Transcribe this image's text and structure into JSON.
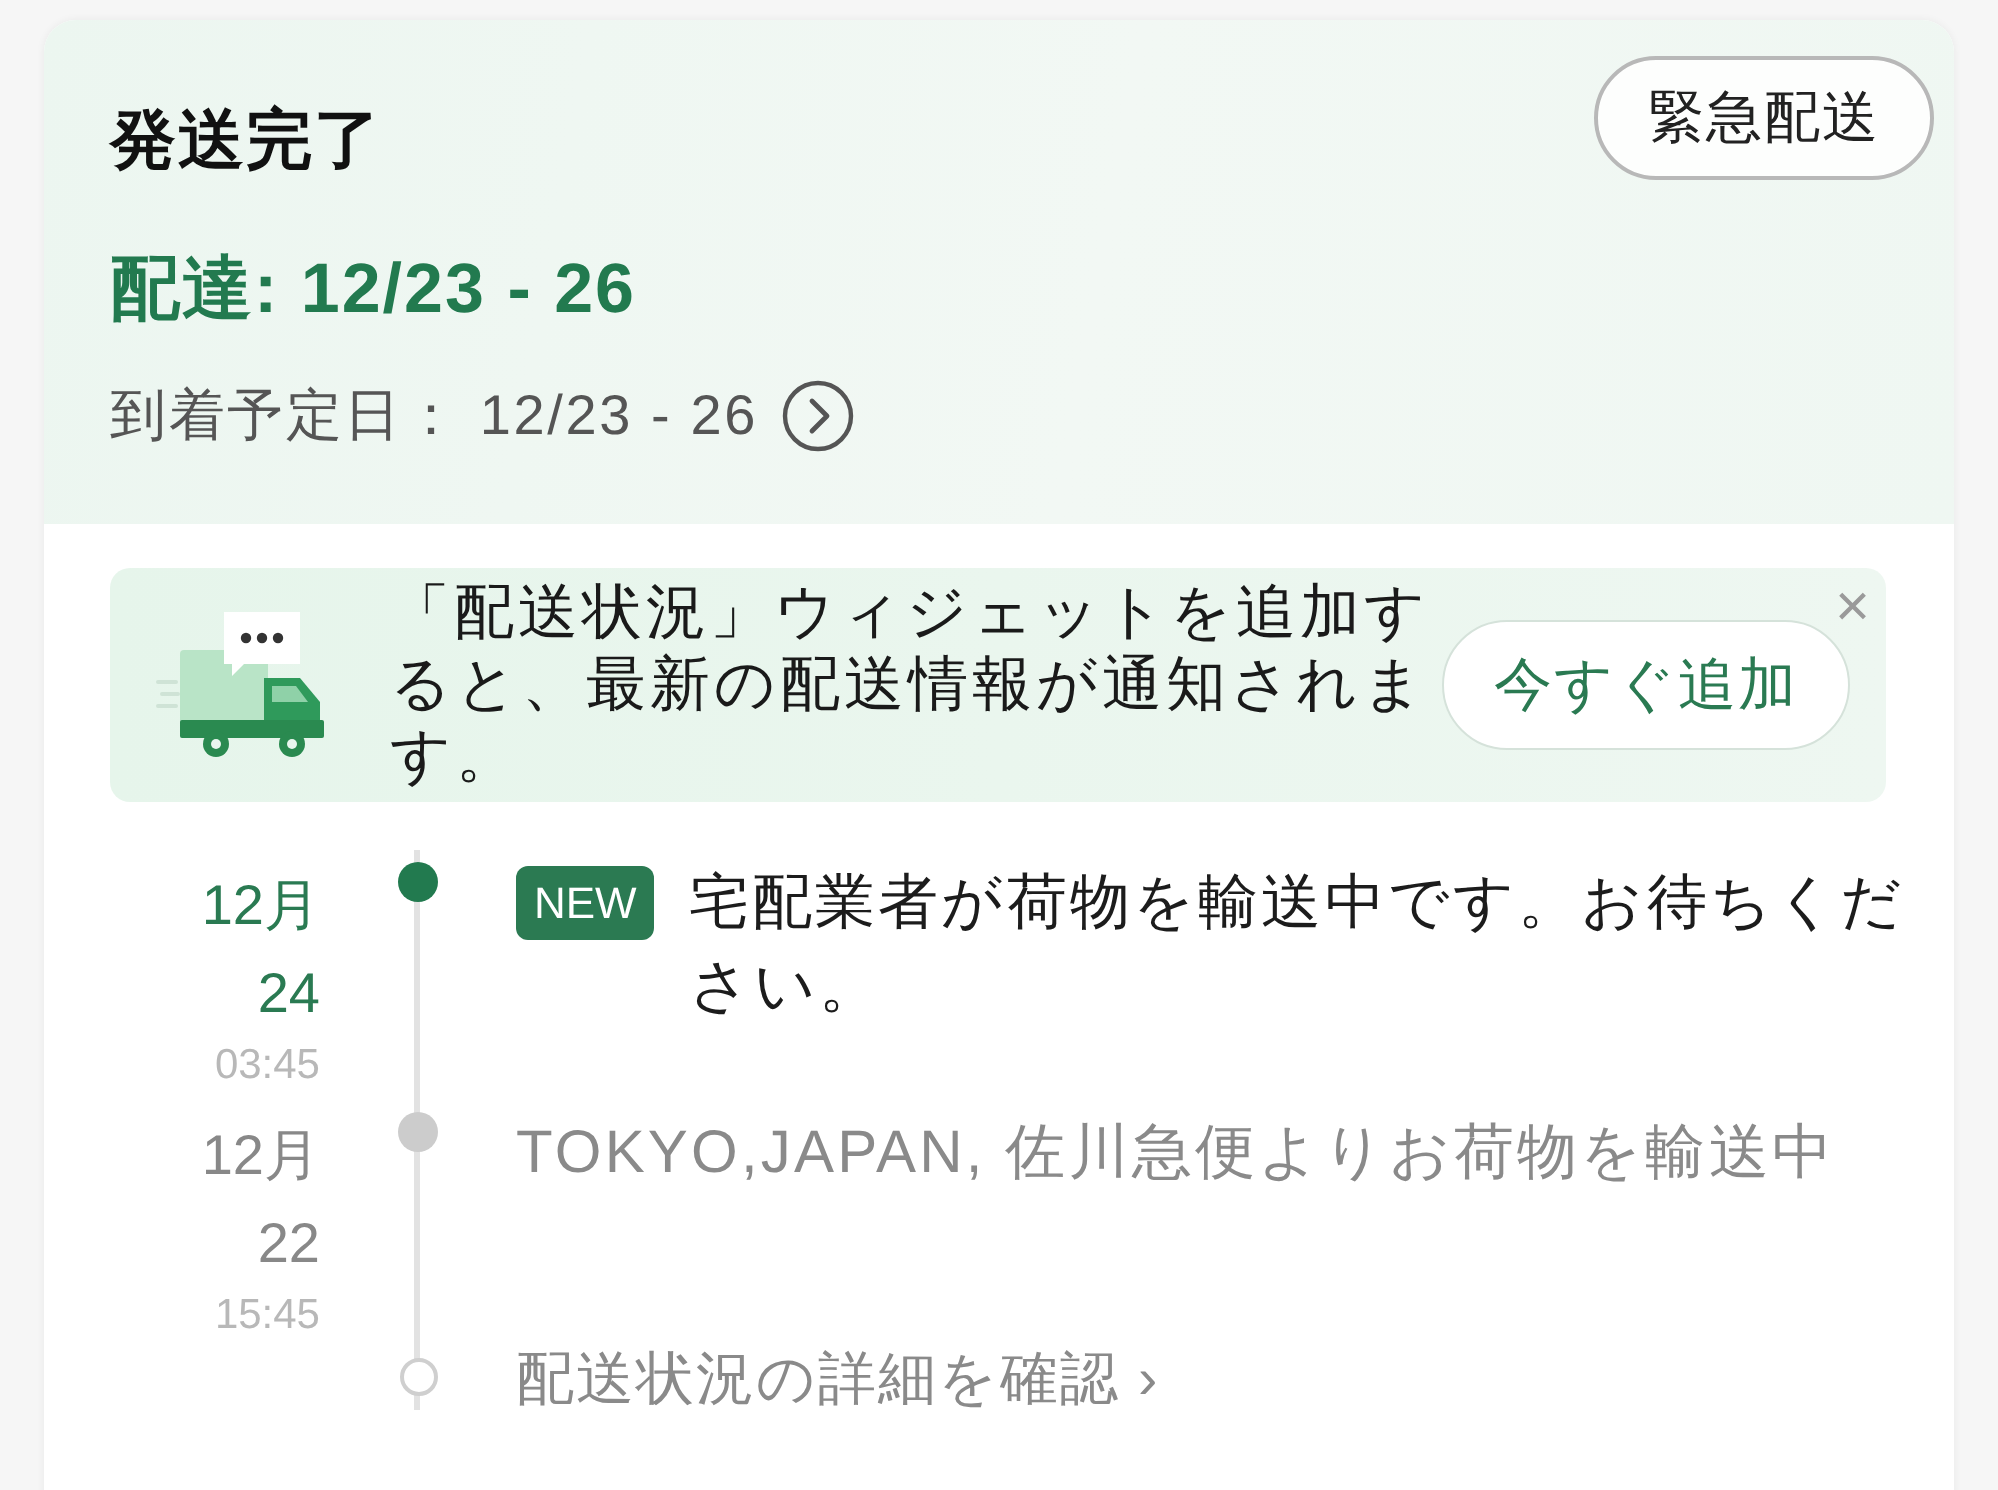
{
  "header": {
    "title": "発送完了",
    "urgent_button": "緊急配送",
    "delivery": "配達: 12/23 - 26",
    "eta": "到着予定日： 12/23 - 26"
  },
  "widget_banner": {
    "message": "「配送状況」ウィジェットを追加すると、最新の配送情報が通知されます。",
    "add_button": "今すぐ追加",
    "close": "×"
  },
  "timeline": {
    "events": [
      {
        "month": "12月",
        "day": "24",
        "time": "03:45",
        "current": true,
        "badge": "NEW",
        "text": "宅配業者が荷物を輸送中です。お待ちください。"
      },
      {
        "month": "12月",
        "day": "22",
        "time": "15:45",
        "current": false,
        "text": "TOKYO,JAPAN, 佐川急便よりお荷物を輸送中"
      }
    ],
    "details_link": "配送状況の詳細を確認 ›"
  }
}
